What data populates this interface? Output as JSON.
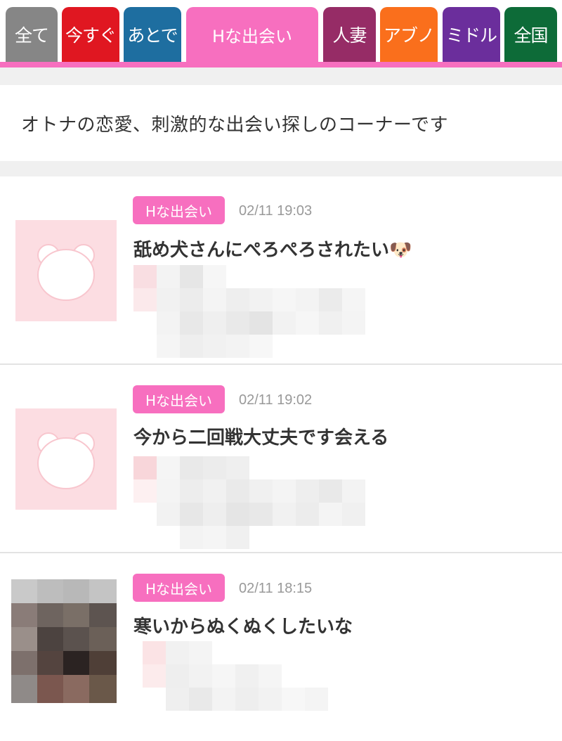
{
  "tabs": [
    {
      "label": "全て",
      "color": "#868686"
    },
    {
      "label": "今すぐ",
      "color": "#e01721"
    },
    {
      "label": "あとで",
      "color": "#1e6ea0"
    },
    {
      "label": "Hな出会い",
      "color": "#f76fbf",
      "active": true
    },
    {
      "label": "人妻",
      "color": "#962c66"
    },
    {
      "label": "アブノ",
      "color": "#fa6f1c"
    },
    {
      "label": "ミドル",
      "color": "#6b2e9c"
    },
    {
      "label": "全国",
      "color": "#0d6b38"
    }
  ],
  "intro": {
    "text": "オトナの恋愛、刺激的な出会い探しのコーナーです"
  },
  "posts": [
    {
      "category": "Hな出会い",
      "datetime": "02/11 19:03",
      "title": "舐め犬さんにぺろぺろされたい🐶",
      "avatar": "default-bear-icon"
    },
    {
      "category": "Hな出会い",
      "datetime": "02/11 19:02",
      "title": "今から二回戦大丈夫です会える",
      "avatar": "default-bear-icon"
    },
    {
      "category": "Hな出会い",
      "datetime": "02/11 18:15",
      "title": "寒いからぬくぬくしたいな",
      "avatar": "user-photo-blurred"
    }
  ]
}
